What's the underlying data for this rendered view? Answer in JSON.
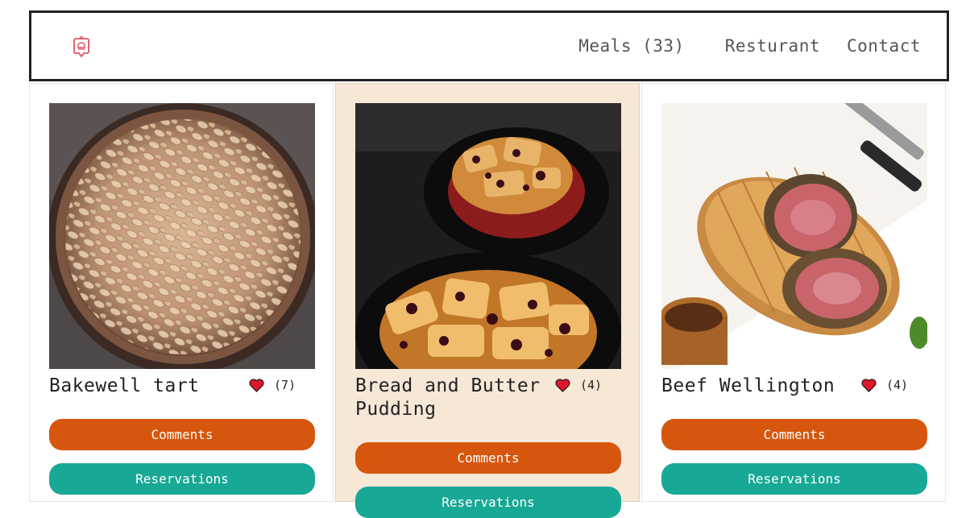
{
  "header": {
    "logo_icon": "chef-hat-icon",
    "nav": {
      "meals": "Meals (33)",
      "restaurant": "Resturant",
      "contact": "Contact"
    }
  },
  "meals": [
    {
      "name": "Bakewell tart",
      "likes": "(7)",
      "comments_label": "Comments",
      "reservations_label": "Reservations"
    },
    {
      "name": "Bread and Butter Pudding",
      "likes": "(4)",
      "comments_label": "Comments",
      "reservations_label": "Reservations"
    },
    {
      "name": "Beef Wellington",
      "likes": "(4)",
      "comments_label": "Comments",
      "reservations_label": "Reservations"
    }
  ],
  "colors": {
    "accent_orange": "#d5560c",
    "accent_teal": "#18a896",
    "heart_red": "#e0162b",
    "highlight_card": "#f7e7d6"
  }
}
